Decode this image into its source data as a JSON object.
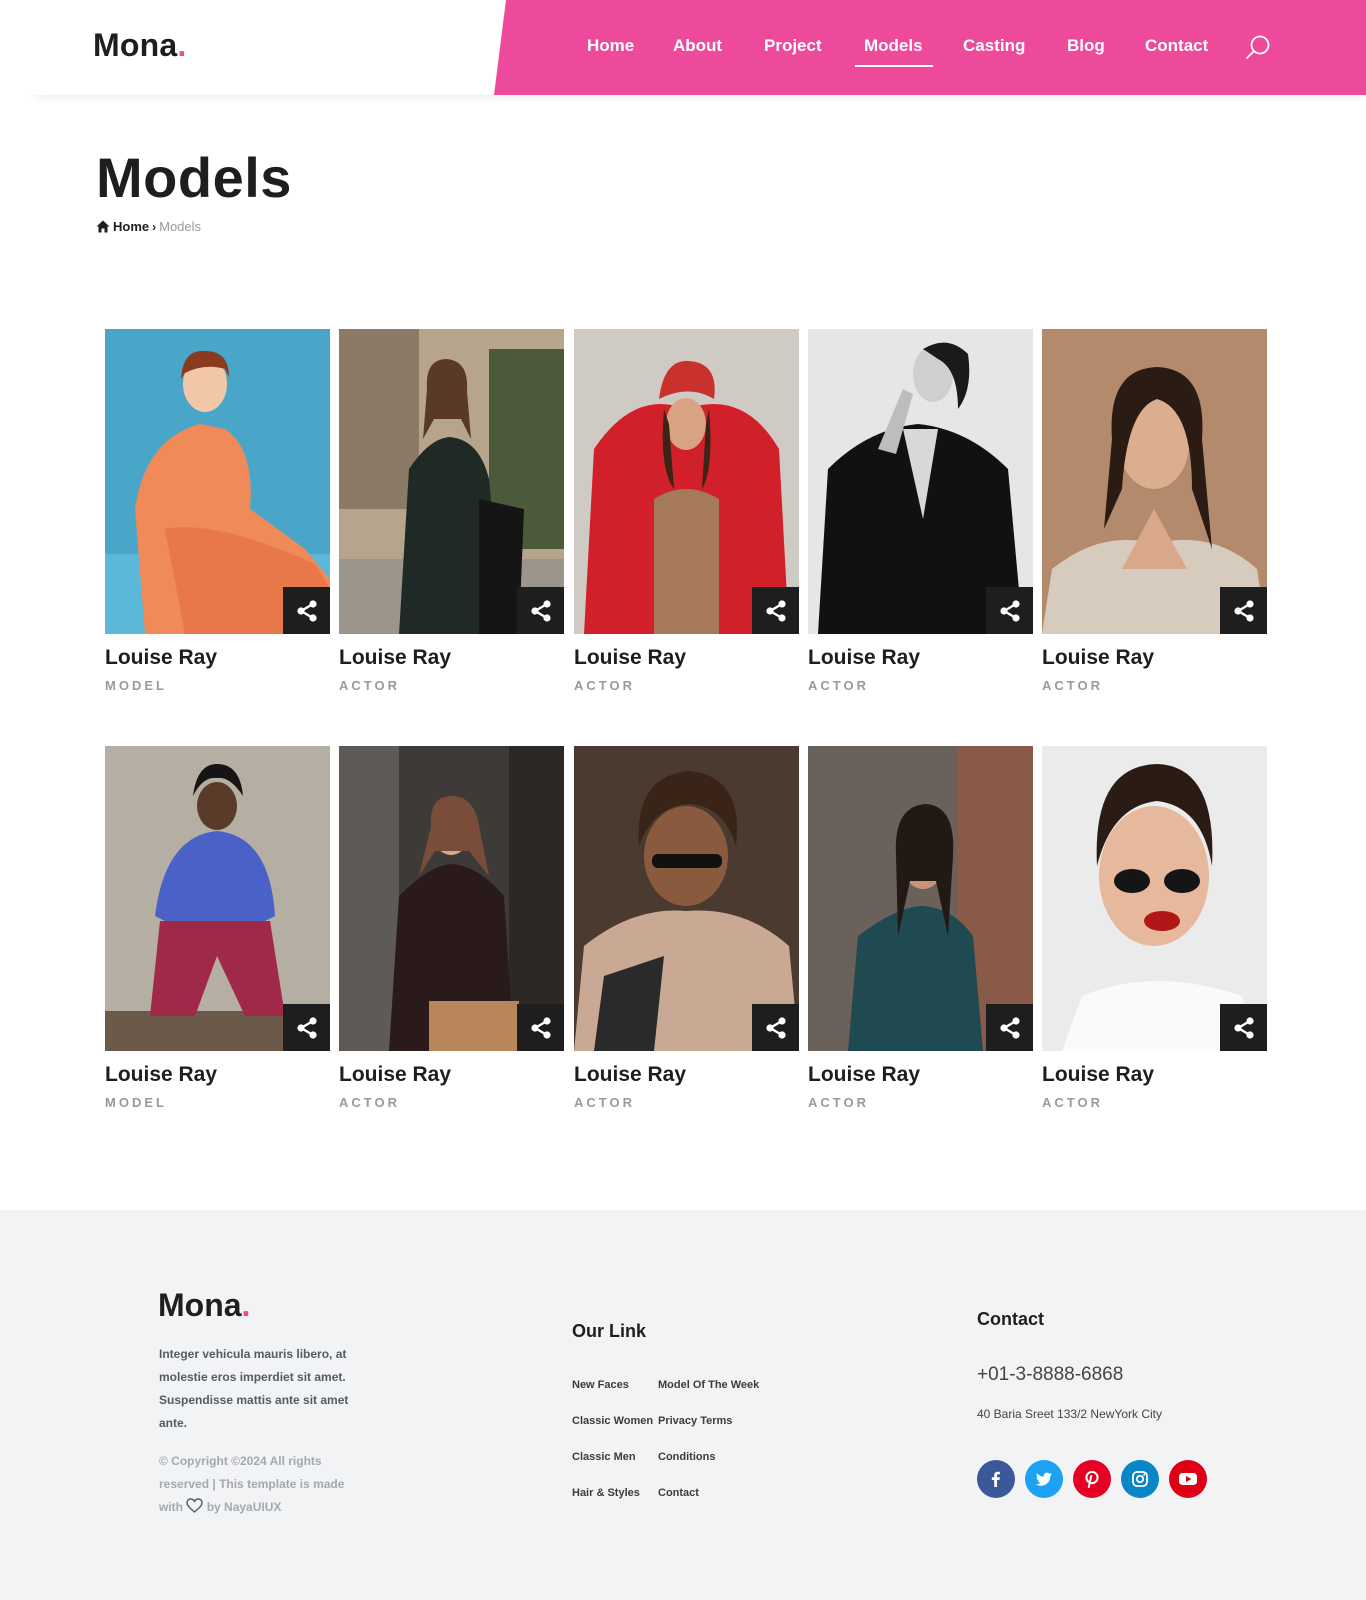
{
  "header": {
    "logo_text": "Mona",
    "logo_dot": ".",
    "nav": [
      "Home",
      "About",
      "Project",
      "Models",
      "Casting",
      "Blog",
      "Contact"
    ],
    "active_nav": "Models",
    "accent_color": "#ee4a9c"
  },
  "page": {
    "title": "Models",
    "breadcrumb": {
      "home": "Home",
      "separator": "›",
      "current": "Models"
    }
  },
  "models": [
    {
      "name": "Louise Ray",
      "role": "MODEL"
    },
    {
      "name": "Louise Ray",
      "role": "ACTOR"
    },
    {
      "name": "Louise Ray",
      "role": "ACTOR"
    },
    {
      "name": "Louise Ray",
      "role": "ACTOR"
    },
    {
      "name": "Louise Ray",
      "role": "ACTOR"
    },
    {
      "name": "Louise Ray",
      "role": "MODEL"
    },
    {
      "name": "Louise Ray",
      "role": "ACTOR"
    },
    {
      "name": "Louise Ray",
      "role": "ACTOR"
    },
    {
      "name": "Louise Ray",
      "role": "ACTOR"
    },
    {
      "name": "Louise Ray",
      "role": "ACTOR"
    }
  ],
  "footer": {
    "logo_text": "Mona",
    "logo_dot": ".",
    "description": "Integer vehicula mauris libero, at molestie eros imperdiet sit amet. Suspendisse mattis ante sit amet ante.",
    "copyright_before": "© Copyright ©2024 All rights reserved | This template is made with",
    "copyright_after": "by NayaUIUX",
    "links_heading": "Our Link",
    "links_col1": [
      "New Faces",
      "Classic Women",
      "Classic Men",
      "Hair & Styles"
    ],
    "links_col2": [
      "Model Of The Week",
      "Privacy Terms",
      "Conditions",
      "Contact"
    ],
    "contact_heading": "Contact",
    "phone": "+01-3-8888-6868",
    "address": "40 Baria Sreet 133/2 NewYork City",
    "social": [
      {
        "icon": "facebook-icon",
        "color": "#3b5998"
      },
      {
        "icon": "twitter-icon",
        "color": "#1da1f2"
      },
      {
        "icon": "pinterest-icon",
        "color": "#e60023"
      },
      {
        "icon": "instagram-icon",
        "color": "#0a86c7"
      },
      {
        "icon": "youtube-icon",
        "color": "#e00016"
      }
    ]
  }
}
